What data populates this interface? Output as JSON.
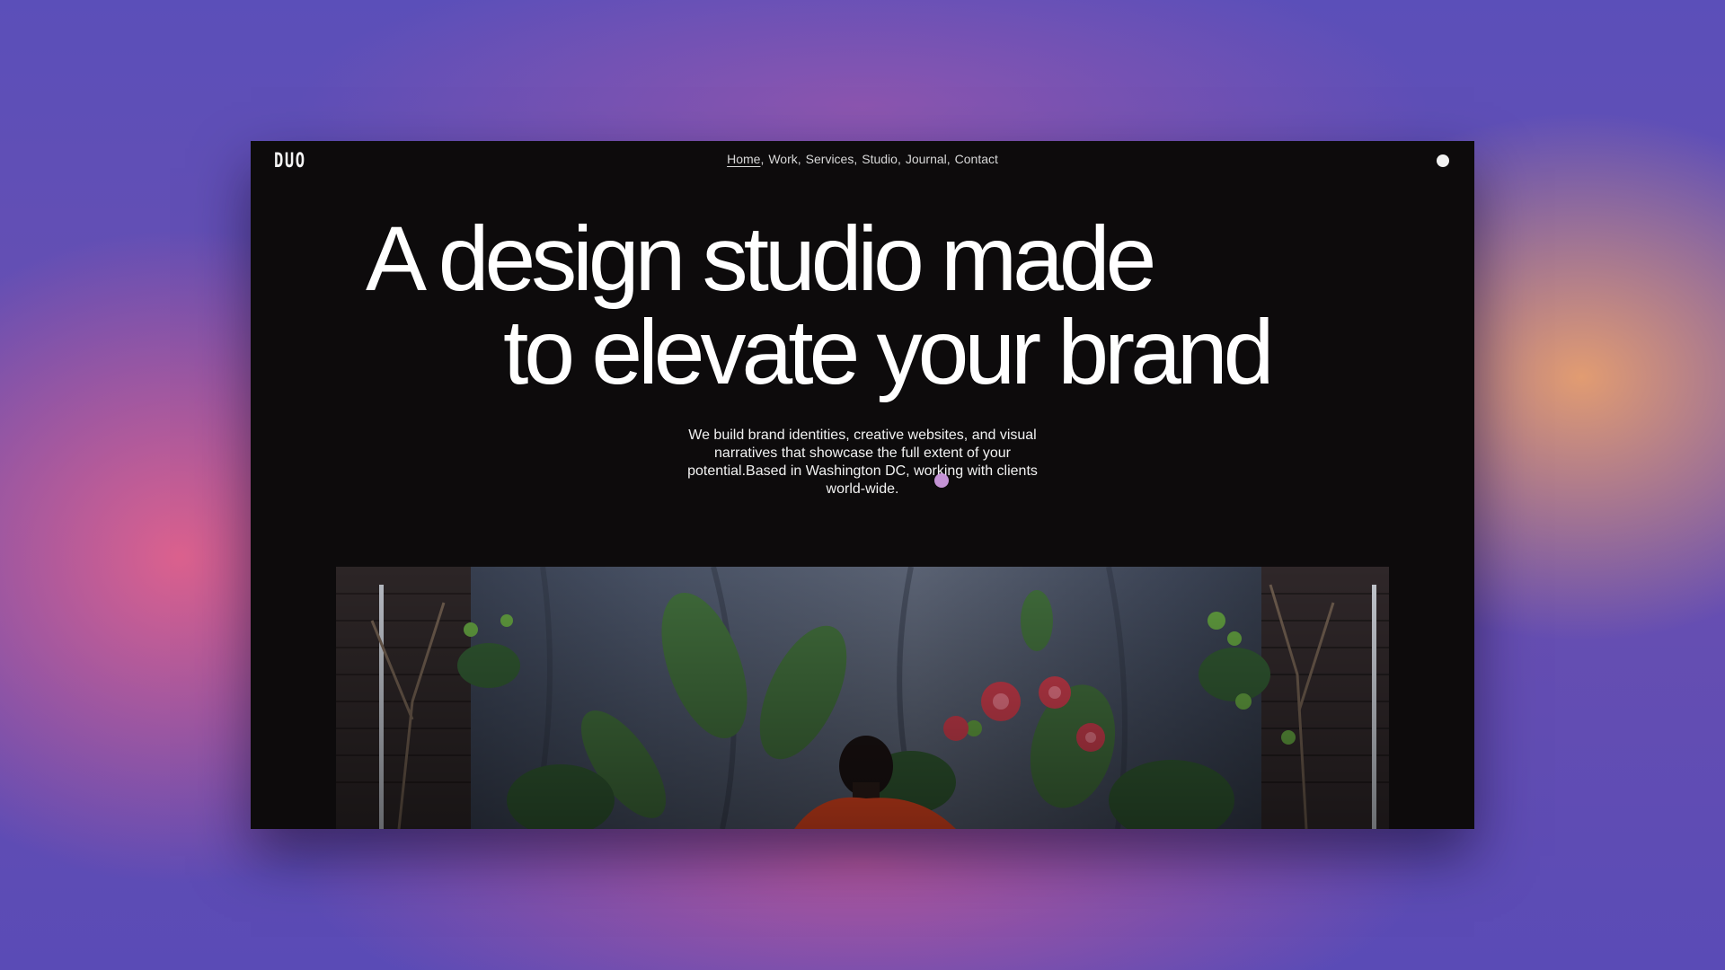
{
  "colors": {
    "page_background": "#0d0b0c",
    "text": "#ffffff",
    "nav_text": "#d8d8d8",
    "cursor": "#cf9be0",
    "backdrop_purple": "#5a4fb8",
    "backdrop_pink": "#e2628c",
    "backdrop_orange": "#e8a06e"
  },
  "header": {
    "logo": "DUO",
    "nav": [
      {
        "label": "Home",
        "active": true
      },
      {
        "label": "Work"
      },
      {
        "label": "Services"
      },
      {
        "label": "Studio"
      },
      {
        "label": "Journal"
      },
      {
        "label": "Contact"
      }
    ],
    "menu_icon": "dot-menu-icon"
  },
  "hero": {
    "line1": "A design studio made",
    "line2": "to elevate your brand",
    "intro": "We build brand identities, creative websites, and visual narratives that showcase the full extent of your potential.Based in Washington DC, working with clients world-wide."
  },
  "media": {
    "icon": "hero-video-image"
  }
}
